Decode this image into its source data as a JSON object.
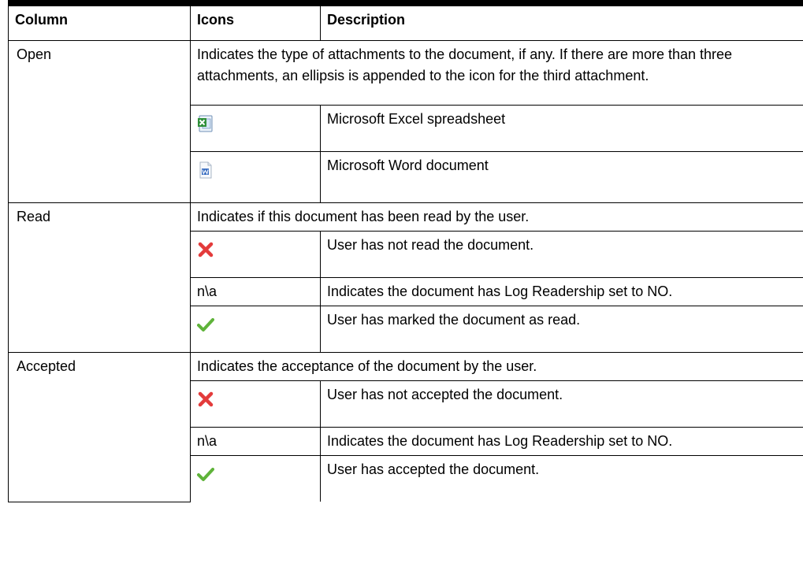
{
  "header": {
    "col1": "Column",
    "col2": "Icons",
    "col3": "Description"
  },
  "open": {
    "column": "Open",
    "description": "Indicates the type of attachments to the document, if any. If there are more than three attachments, an ellipsis is appended to the icon for the third attachment.",
    "items": [
      {
        "icon": "excel-file-icon",
        "description": "Microsoft Excel spreadsheet"
      },
      {
        "icon": "word-file-icon",
        "description": "Microsoft Word document"
      }
    ]
  },
  "read": {
    "column": "Read",
    "description": "Indicates if this document has been read by the user.",
    "items": [
      {
        "icon": "red-x-icon",
        "description": "User has not read the document."
      },
      {
        "icon_text": "n\\a",
        "description": "Indicates the document has Log Readership set to NO."
      },
      {
        "icon": "green-check-icon",
        "description": "User has marked the document as read."
      }
    ]
  },
  "accepted": {
    "column": "Accepted",
    "description": "Indicates the acceptance of the document by the user.",
    "items": [
      {
        "icon": "red-x-icon",
        "description": "User has not accepted the document."
      },
      {
        "icon_text": "n\\a",
        "description": "Indicates the document has Log Readership set to NO."
      },
      {
        "icon": "green-check-icon",
        "description": "User has accepted the document."
      }
    ]
  }
}
